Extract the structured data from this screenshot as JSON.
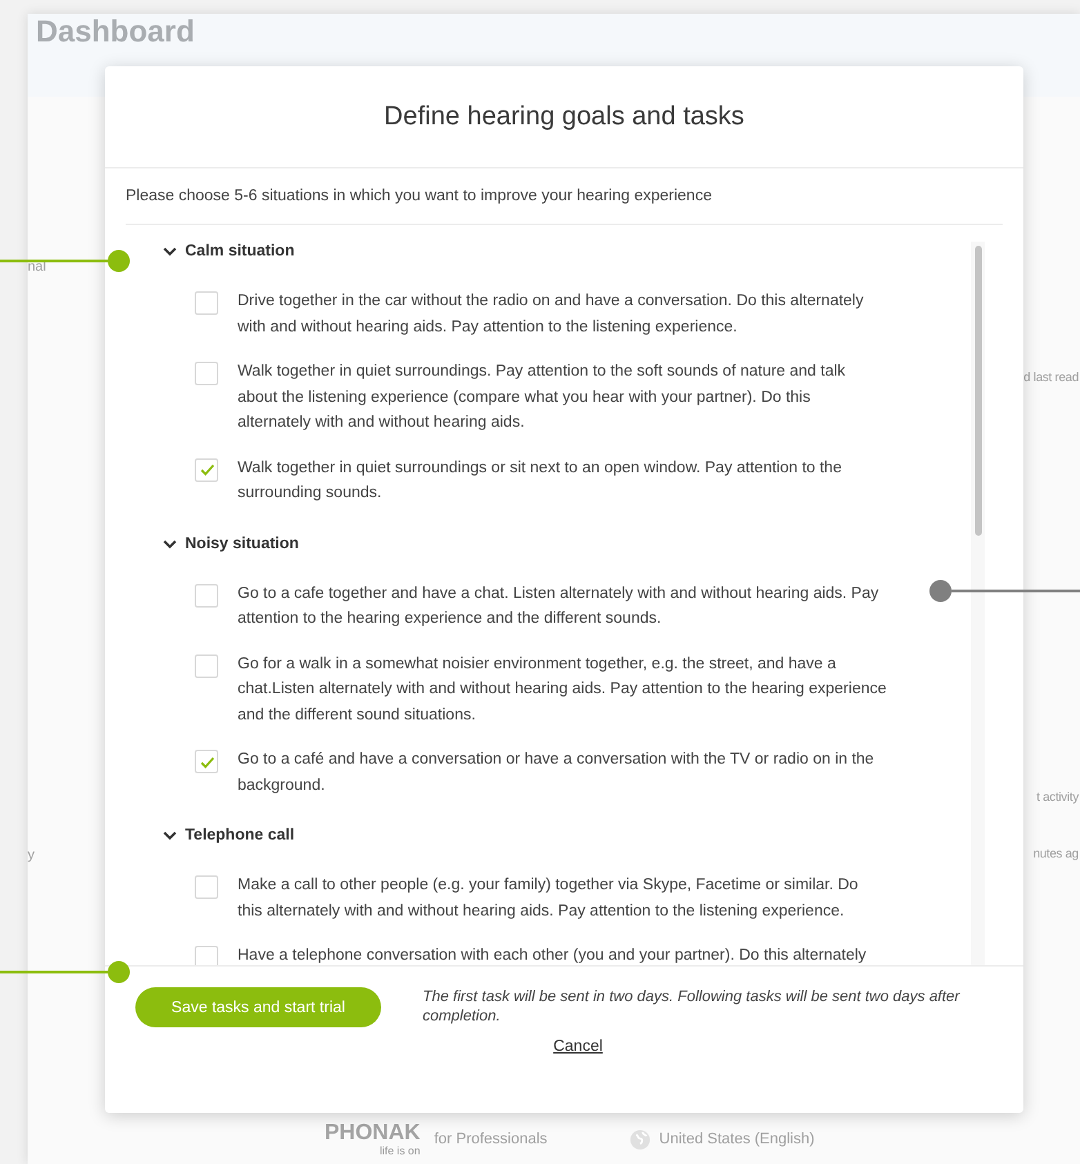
{
  "background": {
    "title": "Dashboard",
    "left_labels": [
      "nal",
      "y"
    ],
    "right_labels": [
      "d last read",
      "t activity",
      "nutes ag"
    ]
  },
  "dialog": {
    "title": "Define hearing goals and tasks",
    "intro": "Please choose 5-6 situations in which you want to improve your hearing experience",
    "groups": [
      {
        "title": "Calm situation",
        "expanded": true,
        "tasks": [
          {
            "text": "Drive together in the car without the radio on and have a conversation. Do this alternately with and without hearing aids. Pay attention to the listening experience.",
            "checked": false
          },
          {
            "text": "Walk together in quiet surroundings. Pay attention to the soft sounds of nature and talk about the listening experience (compare what you hear with your partner). Do this alternately with and without hearing aids.",
            "checked": false
          },
          {
            "text": "Walk together in quiet surroundings or sit next to an open window. Pay attention to the surrounding sounds.",
            "checked": true
          }
        ]
      },
      {
        "title": "Noisy situation",
        "expanded": true,
        "tasks": [
          {
            "text": "Go to a cafe together and have a chat. Listen alternately with and without hearing aids. Pay attention to the hearing experience and the different sounds.",
            "checked": false
          },
          {
            "text": "Go for a walk in a somewhat noisier environment together, e.g. the street, and have a chat.Listen alternately with and without hearing aids. Pay attention to the hearing experience and the different sound situations.",
            "checked": false
          },
          {
            "text": "Go to a café and have a conversation or have a conversation with the TV or radio on in the background.",
            "checked": true
          }
        ]
      },
      {
        "title": "Telephone call",
        "expanded": true,
        "tasks": [
          {
            "text": "Make a call to other people (e.g. your family) together via Skype, Facetime or similar. Do this alternately with and without hearing aids. Pay attention to the listening experience.",
            "checked": false
          },
          {
            "text": "Have a telephone conversation with each other (you and your partner). Do this alternately",
            "checked": false
          }
        ]
      }
    ],
    "save_button": "Save tasks and start trial",
    "note": "The first task will be sent in two days. Following tasks will be sent two days after completion.",
    "cancel": "Cancel"
  },
  "footer": {
    "brand": "PHONAK",
    "tagline": "life is on",
    "site": "for Professionals",
    "region": "United States (English)"
  },
  "callouts": [
    {
      "color": "#8cbd0e"
    },
    {
      "color": "#808080"
    },
    {
      "color": "#8cbd0e"
    }
  ]
}
